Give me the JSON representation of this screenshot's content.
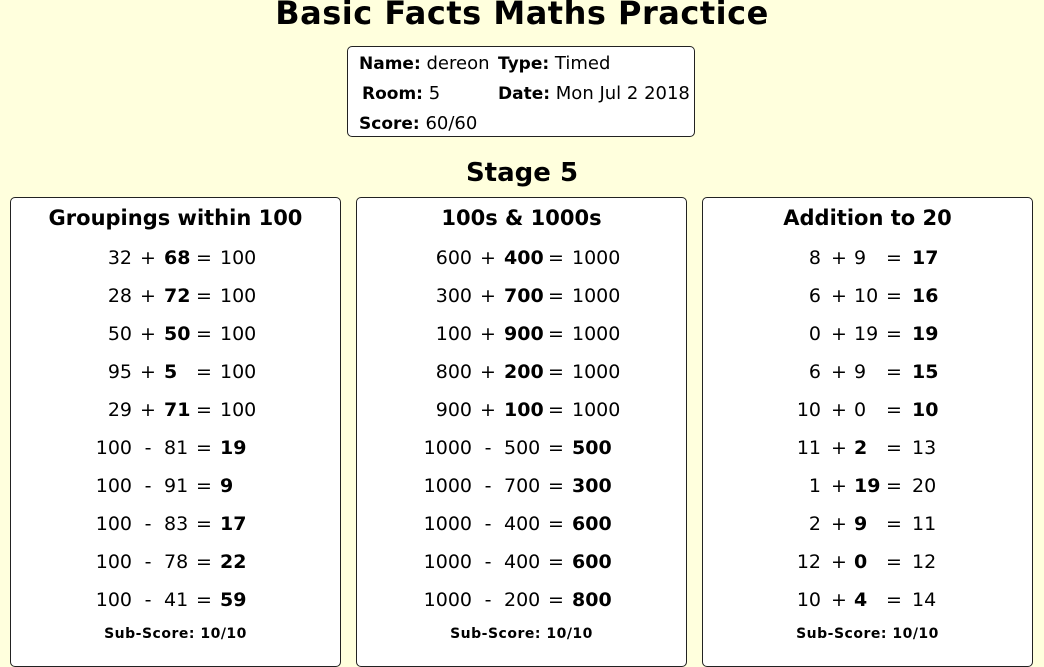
{
  "title": "Basic Facts Maths Practice",
  "info": {
    "name_label": "Name:",
    "name": "dereon",
    "type_label": "Type:",
    "type": "Timed",
    "room_label": "Room:",
    "room": "5",
    "date_label": "Date:",
    "date": "Mon Jul 2 2018",
    "score_label": "Score:",
    "score": "60/60"
  },
  "stage": "Stage 5",
  "panels": [
    {
      "title": "Groupings within 100",
      "subscore": "Sub-Score: 10/10",
      "equations": [
        {
          "a": "32",
          "op": "+",
          "b": "68",
          "eq": "=",
          "c": "100",
          "ans": "b"
        },
        {
          "a": "28",
          "op": "+",
          "b": "72",
          "eq": "=",
          "c": "100",
          "ans": "b"
        },
        {
          "a": "50",
          "op": "+",
          "b": "50",
          "eq": "=",
          "c": "100",
          "ans": "b"
        },
        {
          "a": "95",
          "op": "+",
          "b": "5",
          "eq": "=",
          "c": "100",
          "ans": "b"
        },
        {
          "a": "29",
          "op": "+",
          "b": "71",
          "eq": "=",
          "c": "100",
          "ans": "b"
        },
        {
          "a": "100",
          "op": "-",
          "b": "81",
          "eq": "=",
          "c": "19",
          "ans": "c"
        },
        {
          "a": "100",
          "op": "-",
          "b": "91",
          "eq": "=",
          "c": "9",
          "ans": "c"
        },
        {
          "a": "100",
          "op": "-",
          "b": "83",
          "eq": "=",
          "c": "17",
          "ans": "c"
        },
        {
          "a": "100",
          "op": "-",
          "b": "78",
          "eq": "=",
          "c": "22",
          "ans": "c"
        },
        {
          "a": "100",
          "op": "-",
          "b": "41",
          "eq": "=",
          "c": "59",
          "ans": "c"
        }
      ]
    },
    {
      "title": "100s & 1000s",
      "subscore": "Sub-Score: 10/10",
      "equations": [
        {
          "a": "600",
          "op": "+",
          "b": "400",
          "eq": "=",
          "c": "1000",
          "ans": "b"
        },
        {
          "a": "300",
          "op": "+",
          "b": "700",
          "eq": "=",
          "c": "1000",
          "ans": "b"
        },
        {
          "a": "100",
          "op": "+",
          "b": "900",
          "eq": "=",
          "c": "1000",
          "ans": "b"
        },
        {
          "a": "800",
          "op": "+",
          "b": "200",
          "eq": "=",
          "c": "1000",
          "ans": "b"
        },
        {
          "a": "900",
          "op": "+",
          "b": "100",
          "eq": "=",
          "c": "1000",
          "ans": "b"
        },
        {
          "a": "1000",
          "op": "-",
          "b": "500",
          "eq": "=",
          "c": "500",
          "ans": "c"
        },
        {
          "a": "1000",
          "op": "-",
          "b": "700",
          "eq": "=",
          "c": "300",
          "ans": "c"
        },
        {
          "a": "1000",
          "op": "-",
          "b": "400",
          "eq": "=",
          "c": "600",
          "ans": "c"
        },
        {
          "a": "1000",
          "op": "-",
          "b": "400",
          "eq": "=",
          "c": "600",
          "ans": "c"
        },
        {
          "a": "1000",
          "op": "-",
          "b": "200",
          "eq": "=",
          "c": "800",
          "ans": "c"
        }
      ]
    },
    {
      "title": "Addition to 20",
      "subscore": "Sub-Score: 10/10",
      "equations": [
        {
          "a": "8",
          "op": "+",
          "b": "9",
          "eq": "=",
          "c": "17",
          "ans": "c"
        },
        {
          "a": "6",
          "op": "+",
          "b": "10",
          "eq": "=",
          "c": "16",
          "ans": "c"
        },
        {
          "a": "0",
          "op": "+",
          "b": "19",
          "eq": "=",
          "c": "19",
          "ans": "c"
        },
        {
          "a": "6",
          "op": "+",
          "b": "9",
          "eq": "=",
          "c": "15",
          "ans": "c"
        },
        {
          "a": "10",
          "op": "+",
          "b": "0",
          "eq": "=",
          "c": "10",
          "ans": "c"
        },
        {
          "a": "11",
          "op": "+",
          "b": "2",
          "eq": "=",
          "c": "13",
          "ans": "b"
        },
        {
          "a": "1",
          "op": "+",
          "b": "19",
          "eq": "=",
          "c": "20",
          "ans": "b"
        },
        {
          "a": "2",
          "op": "+",
          "b": "9",
          "eq": "=",
          "c": "11",
          "ans": "b"
        },
        {
          "a": "12",
          "op": "+",
          "b": "0",
          "eq": "=",
          "c": "12",
          "ans": "b"
        },
        {
          "a": "10",
          "op": "+",
          "b": "4",
          "eq": "=",
          "c": "14",
          "ans": "b"
        }
      ]
    }
  ]
}
